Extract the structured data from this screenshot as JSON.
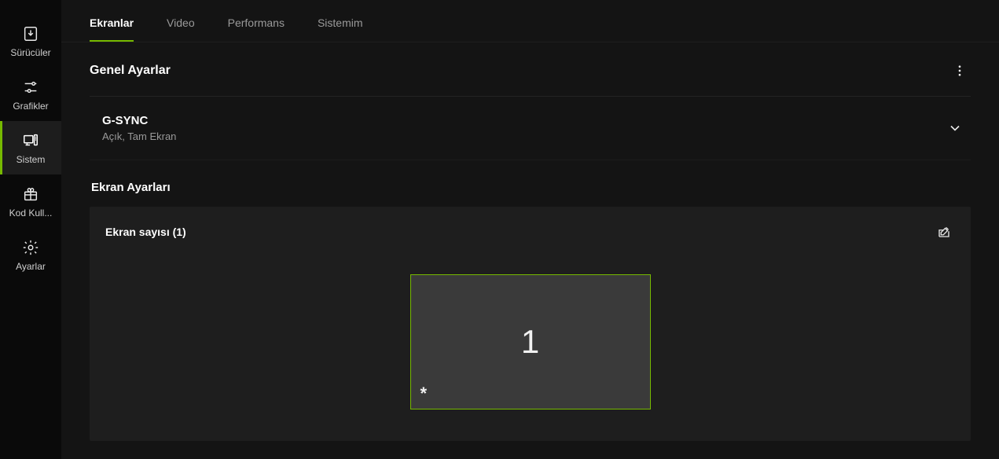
{
  "sidebar": {
    "items": [
      {
        "label": "Sürücüler"
      },
      {
        "label": "Grafikler"
      },
      {
        "label": "Sistem"
      },
      {
        "label": "Kod Kull..."
      },
      {
        "label": "Ayarlar"
      }
    ],
    "active_index": 2
  },
  "tabs": {
    "items": [
      {
        "label": "Ekranlar"
      },
      {
        "label": "Video"
      },
      {
        "label": "Performans"
      },
      {
        "label": "Sistemim"
      }
    ],
    "active_index": 0
  },
  "sections": {
    "general_title": "Genel Ayarlar",
    "gsync": {
      "title": "G-SYNC",
      "subtitle": "Açık, Tam Ekran"
    },
    "display_settings_title": "Ekran Ayarları",
    "display_panel": {
      "title": "Ekran sayısı (1)",
      "monitor_number": "1",
      "primary_marker": "*"
    }
  }
}
